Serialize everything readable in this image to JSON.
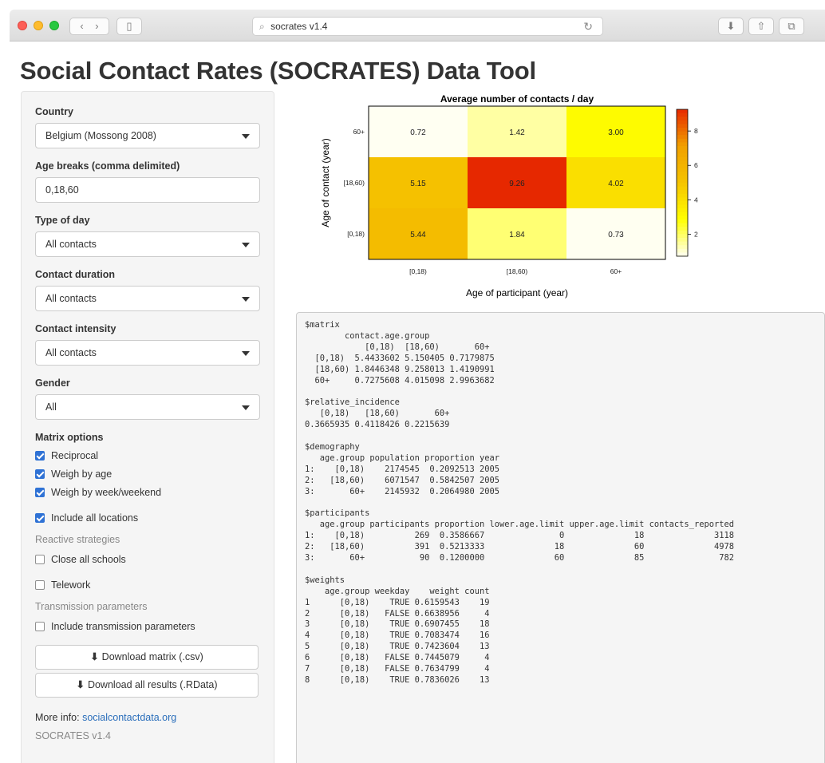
{
  "browser": {
    "url_text": "socrates v1.4",
    "back_glyph": "‹",
    "forward_glyph": "›",
    "sidebar_glyph": "▯",
    "download_glyph": "⬇",
    "share_glyph": "⇧",
    "tabs_glyph": "⧉",
    "search_glyph": "⌕",
    "reload_glyph": "↻"
  },
  "page": {
    "title": "Social Contact Rates (SOCRATES) Data Tool"
  },
  "sidebar": {
    "country_label": "Country",
    "country_value": "Belgium (Mossong 2008)",
    "age_breaks_label": "Age breaks (comma delimited)",
    "age_breaks_value": "0,18,60",
    "type_of_day_label": "Type of day",
    "type_of_day_value": "All contacts",
    "contact_duration_label": "Contact duration",
    "contact_duration_value": "All contacts",
    "contact_intensity_label": "Contact intensity",
    "contact_intensity_value": "All contacts",
    "gender_label": "Gender",
    "gender_value": "All",
    "matrix_options_label": "Matrix options",
    "reciprocal": "Reciprocal",
    "weigh_by_age": "Weigh by age",
    "weigh_by_week": "Weigh by week/weekend",
    "include_all_locations": "Include all locations",
    "reactive_label": "Reactive strategies",
    "close_schools": "Close all schools",
    "telework": "Telework",
    "transmission_label": "Transmission parameters",
    "include_transmission": "Include transmission parameters",
    "download_matrix": "Download matrix (.csv)",
    "download_all": "Download all results (.RData)",
    "more_info_prefix": "More info: ",
    "more_info_link": "socialcontactdata.org",
    "version": "SOCRATES v1.4"
  },
  "chart_data": {
    "type": "heatmap",
    "title": "Average number of contacts / day",
    "xlabel": "Age of participant (year)",
    "ylabel": "Age of contact (year)",
    "x_categories": [
      "[0,18)",
      "[18,60)",
      "60+"
    ],
    "y_categories_top_to_bottom": [
      "60+",
      "[18,60)",
      "[0,18)"
    ],
    "cell_labels_top_to_bottom": [
      [
        "0.72",
        "1.42",
        "3.00"
      ],
      [
        "5.15",
        "9.26",
        "4.02"
      ],
      [
        "5.44",
        "1.84",
        "0.73"
      ]
    ],
    "values_top_to_bottom": [
      [
        0.72,
        1.42,
        3.0
      ],
      [
        5.15,
        9.26,
        4.02
      ],
      [
        5.44,
        1.84,
        0.73
      ]
    ],
    "colorbar_ticks": [
      "2",
      "4",
      "6",
      "8"
    ],
    "colorbar_range": [
      0.72,
      9.26
    ],
    "palette": [
      "#fffff2",
      "#ffff00",
      "#f5c400",
      "#f0a000",
      "#e62800"
    ]
  },
  "output": {
    "text": "$matrix\n        contact.age.group\n            [0,18)  [18,60)       60+\n  [0,18)  5.4433602 5.150405 0.7179875\n  [18,60) 1.8446348 9.258013 1.4190991\n  60+     0.7275608 4.015098 2.9963682\n\n$relative_incidence\n   [0,18)   [18,60)       60+\n0.3665935 0.4118426 0.2215639\n\n$demography\n   age.group population proportion year\n1:    [0,18)    2174545  0.2092513 2005\n2:   [18,60)    6071547  0.5842507 2005\n3:       60+    2145932  0.2064980 2005\n\n$participants\n   age.group participants proportion lower.age.limit upper.age.limit contacts_reported\n1:    [0,18)          269  0.3586667               0              18              3118\n2:   [18,60)          391  0.5213333              18              60              4978\n3:       60+           90  0.1200000              60              85               782\n\n$weights\n    age.group weekday    weight count\n1      [0,18)    TRUE 0.6159543    19\n2      [0,18)   FALSE 0.6638956     4\n3      [0,18)    TRUE 0.6907455    18\n4      [0,18)    TRUE 0.7083474    16\n5      [0,18)    TRUE 0.7423604    13\n6      [0,18)   FALSE 0.7445079     4\n7      [0,18)   FALSE 0.7634799     4\n8      [0,18)    TRUE 0.7836026    13"
  }
}
